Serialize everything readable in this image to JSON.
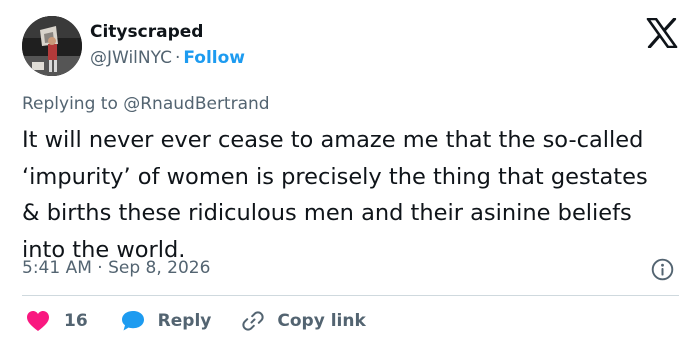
{
  "author": {
    "display_name": "Cityscraped",
    "handle": "@JWilNYC",
    "separator": "·",
    "follow_label": "Follow"
  },
  "tweet": {
    "reply_prefix": "Replying to",
    "reply_mention": "@RnaudBertrand",
    "text": "It will never ever cease to amaze me that the so-called ‘impurity’ of women is precisely the thing that gestates & births these ridiculous men and their asinine beliefs into the world.",
    "timestamp": "5:41 AM · Sep 8, 2026"
  },
  "actions": {
    "like_count": "16",
    "reply_label": "Reply",
    "copy_link_label": "Copy link"
  },
  "icons": {
    "brand": "x-logo-icon",
    "info": "info-icon",
    "like": "heart-icon",
    "reply": "speech-bubble-icon",
    "copy": "link-icon"
  },
  "colors": {
    "text_primary": "#0f1419",
    "text_secondary": "#536471",
    "accent_blue": "#1d9bf0",
    "like_red": "#f91880",
    "divider": "#cfd9de"
  }
}
